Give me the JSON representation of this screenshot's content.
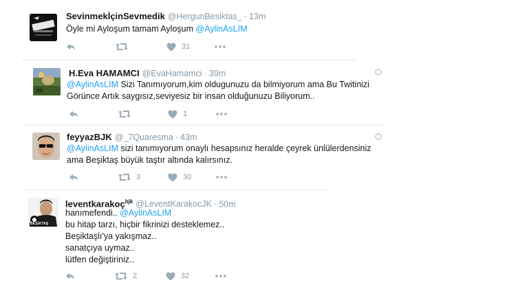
{
  "tweets": [
    {
      "name": "SevinmekİçinSevmedik",
      "handle": "@HergunBesiktas_",
      "sep": "·",
      "time": "13m",
      "lines": [
        {
          "pre": "Öyle mi Ayloşum tamam Ayloşum ",
          "mention": "@AylinAsLIM",
          "post": ""
        }
      ],
      "replies": "",
      "retweets": "",
      "likes": "31"
    },
    {
      "name": "H.Eva HAMAMCI",
      "handle": "@EvaHamamci",
      "sep": "·",
      "time": "39m",
      "lines": [
        {
          "pre": "",
          "mention": "@AylinAsLIM",
          "post": " Sizi Tanımıyorum,kim oldugunuzu da bilmiyorum ama Bu Twitinizi"
        },
        {
          "pre": "Görünce Artık saygısız,seviyesiz bir insan olduğunuzu Biliyorum..",
          "mention": "",
          "post": ""
        }
      ],
      "replies": "",
      "retweets": "",
      "likes": "1"
    },
    {
      "name": "feyyazBJK",
      "handle": "@_7Quaresma",
      "sep": "·",
      "time": "43m",
      "lines": [
        {
          "pre": "",
          "mention": "@AylinAsLIM",
          "post": " sizi tanımıyorum onaylı hesapsınız heralde çeyrek ünlülerdensiniz"
        },
        {
          "pre": "ama Beşiktaş büyük taştır altında kalırsınız.",
          "mention": "",
          "post": ""
        }
      ],
      "replies": "",
      "retweets": "3",
      "likes": "30"
    },
    {
      "name": "leventkarakoç",
      "name_sup": "bjk",
      "handle": "@LeventKarakocJK",
      "sep": "·",
      "time": "50m",
      "lines": [
        {
          "pre": "hanımefendi.. ",
          "mention": "@AylinAsLIM",
          "post": ""
        },
        {
          "pre": "bu hitap tarzı, hiçbir fikrinizi desteklemez..",
          "mention": "",
          "post": ""
        },
        {
          "pre": "Beşiktaşlı'ya yakışmaz..",
          "mention": "",
          "post": ""
        },
        {
          "pre": "sanatçıya uymaz..",
          "mention": "",
          "post": ""
        },
        {
          "pre": "lütfen değiştiriniz..",
          "mention": "",
          "post": ""
        }
      ],
      "replies": "",
      "retweets": "2",
      "likes": "32"
    }
  ],
  "avatar_labels": {
    "t4_badge": "BEŞİKTAŞ"
  },
  "colors": {
    "mention": "#1da1f2",
    "muted": "#8899a6",
    "text": "#14171a",
    "divider": "#e6ecf0"
  }
}
